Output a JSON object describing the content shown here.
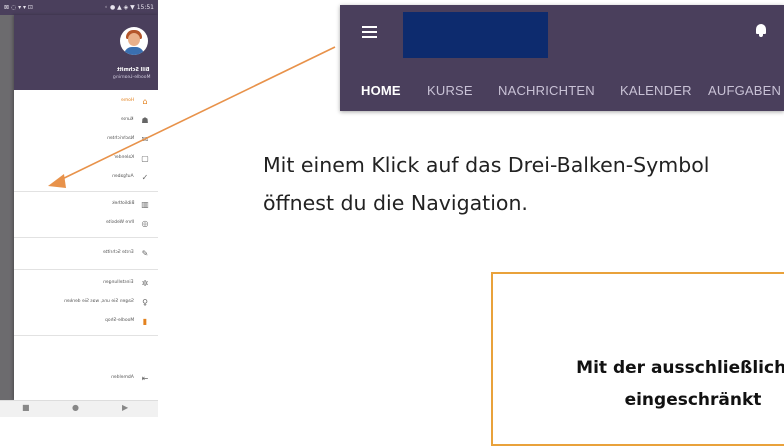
{
  "phone": {
    "status_left": "⊠ ◌ ▾ ▾ ⊡",
    "status_right": "◦ ● ▲ ◈ ▼ 15:51",
    "drawer": {
      "user_name": "Bill Schmitt",
      "user_subtitle": "Moodle-Learning",
      "items": [
        {
          "label": "Home",
          "icon": "home-icon",
          "glyph": "⌂",
          "active": true
        },
        {
          "label": "Kurse",
          "icon": "school-icon",
          "glyph": "☗",
          "active": false
        },
        {
          "label": "Nachrichten",
          "icon": "chat-icon",
          "glyph": "✉",
          "active": false
        },
        {
          "label": "Kalender",
          "icon": "calendar-icon",
          "glyph": "▢",
          "active": false
        },
        {
          "label": "Aufgaben",
          "icon": "check-icon",
          "glyph": "✓",
          "active": false
        },
        {
          "label": "Bibliothek",
          "icon": "library-icon",
          "glyph": "▥",
          "active": false
        },
        {
          "label": "Ihre Website",
          "icon": "globe-icon",
          "glyph": "◎",
          "active": false
        },
        {
          "label": "Erste Schritte",
          "icon": "pencil-icon",
          "glyph": "✎",
          "active": false
        },
        {
          "label": "Einstellungen",
          "icon": "gear-icon",
          "glyph": "✲",
          "active": false
        },
        {
          "label": "Sagen Sie uns, was Sie denken",
          "icon": "lightbulb-icon",
          "glyph": "♀",
          "active": false
        },
        {
          "label": "Moodle-Shop",
          "icon": "shop-icon",
          "glyph": "▮",
          "active": false
        },
        {
          "label": "Abmelden",
          "icon": "logout-icon",
          "glyph": "⇤",
          "active": false
        }
      ]
    },
    "navbar": {
      "back": "■",
      "home": "●",
      "recent": "▶"
    }
  },
  "appbar": {
    "tabs": [
      "HOME",
      "KURSE",
      "NACHRICHTEN",
      "KALENDER",
      "AUFGABEN"
    ],
    "active_tab": "HOME",
    "colors": {
      "bar": "#4a3f5c",
      "logo": "#0d2b6e",
      "accent": "#e3821f"
    }
  },
  "instruction": {
    "line1": "Mit einem Klick auf das Drei-Balken-Symbol",
    "line2": "öffnest du die Navigation."
  },
  "notice": {
    "line1": "Mit der ausschließlichen",
    "line2": "eingeschränkt"
  }
}
